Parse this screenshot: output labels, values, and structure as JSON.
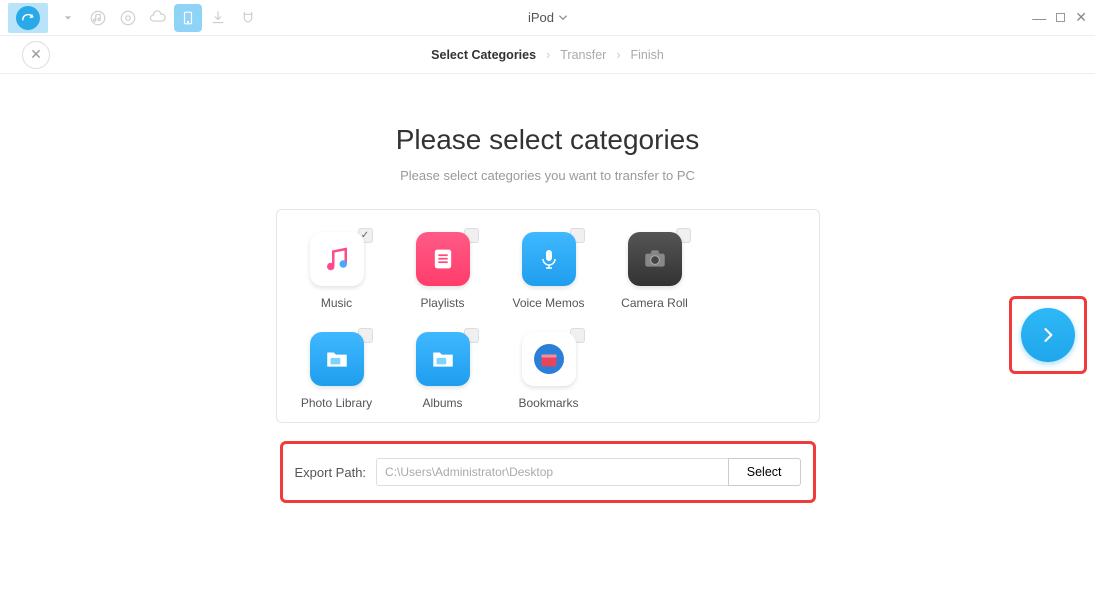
{
  "device_name": "iPod",
  "breadcrumb": {
    "step1": "Select Categories",
    "step2": "Transfer",
    "step3": "Finish"
  },
  "page_title": "Please select categories",
  "page_subtitle": "Please select categories you want to transfer to PC",
  "categories": [
    {
      "label": "Music",
      "checked": true
    },
    {
      "label": "Playlists",
      "checked": false
    },
    {
      "label": "Voice Memos",
      "checked": false
    },
    {
      "label": "Camera Roll",
      "checked": false
    },
    {
      "label": "Photo Library",
      "checked": false
    },
    {
      "label": "Albums",
      "checked": false
    },
    {
      "label": "Bookmarks",
      "checked": false
    }
  ],
  "export": {
    "label": "Export Path:",
    "path": "C:\\Users\\Administrator\\Desktop",
    "select_label": "Select"
  }
}
